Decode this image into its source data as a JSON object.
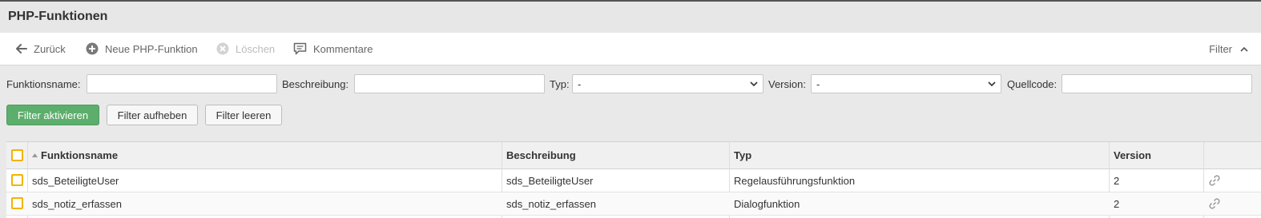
{
  "page": {
    "title": "PHP-Funktionen"
  },
  "toolbar": {
    "back_label": "Zurück",
    "new_label": "Neue PHP-Funktion",
    "delete_label": "Löschen",
    "comments_label": "Kommentare",
    "filter_label": "Filter"
  },
  "filters": {
    "name_label": "Funktionsname:",
    "name_value": "",
    "description_label": "Beschreibung:",
    "description_value": "",
    "type_label": "Typ:",
    "type_value": "-",
    "version_label": "Version:",
    "version_value": "-",
    "source_label": "Quellcode:",
    "source_value": ""
  },
  "filter_buttons": {
    "activate": "Filter aktivieren",
    "remove": "Filter aufheben",
    "clear": "Filter leeren"
  },
  "table": {
    "columns": [
      "Funktionsname",
      "Beschreibung",
      "Typ",
      "Version"
    ],
    "rows": [
      {
        "name": "sds_BeteiligteUser",
        "description": "sds_BeteiligteUser",
        "type": "Regelausführungsfunktion",
        "version": "2"
      },
      {
        "name": "sds_notiz_erfassen",
        "description": "sds_notiz_erfassen",
        "type": "Dialogfunktion",
        "version": "2"
      }
    ]
  },
  "colors": {
    "accent_checkbox": "#f0b400",
    "primary_button": "#5cae6c"
  },
  "icons": [
    "arrow-left-icon",
    "plus-circle-icon",
    "x-circle-icon",
    "comment-icon",
    "chevron-up-icon",
    "chevron-down-icon",
    "link-icon",
    "sort-asc-icon"
  ]
}
